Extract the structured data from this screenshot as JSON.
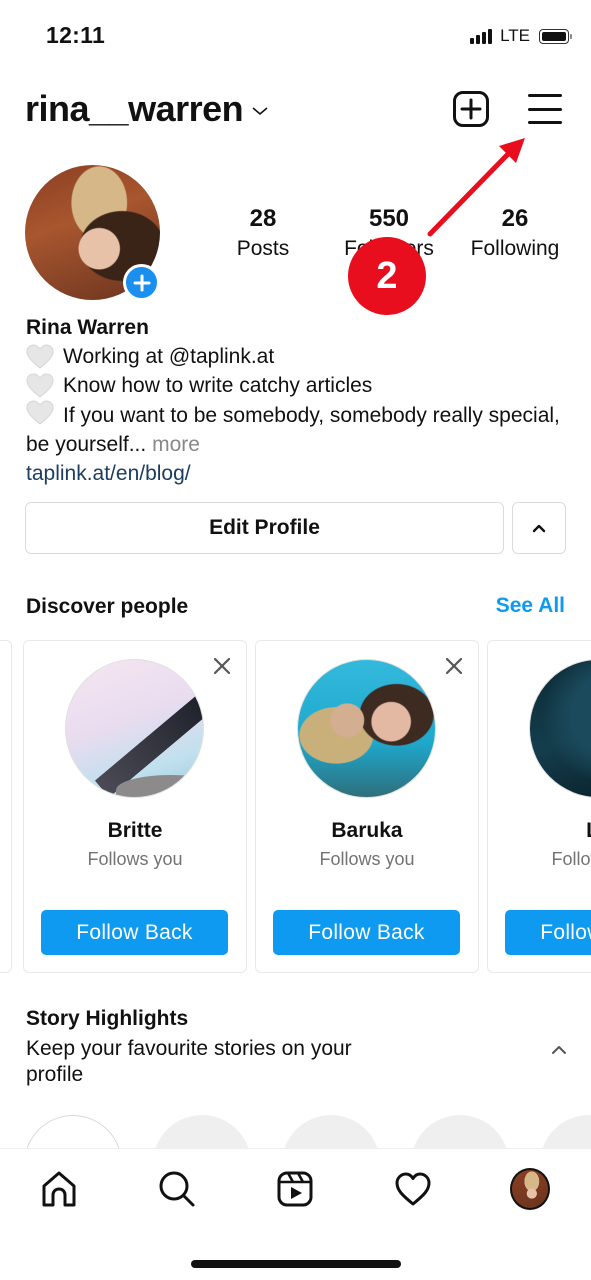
{
  "status_bar": {
    "time": "12:11",
    "network": "LTE",
    "signal_icon": "cellular-signal-icon",
    "battery_icon": "battery-icon"
  },
  "header": {
    "username": "rina__warren",
    "account_switch_icon": "chevron-down-icon",
    "new_post_icon": "plus-square-icon",
    "menu_icon": "hamburger-menu-icon"
  },
  "profile": {
    "avatar_icon": "profile-photo",
    "add_story_icon": "plus-circle-icon",
    "stats": [
      {
        "value": "28",
        "label": "Posts"
      },
      {
        "value": "550",
        "label": "Followers"
      },
      {
        "value": "26",
        "label": "Following"
      }
    ],
    "display_name": "Rina Warren",
    "bio_lines": [
      "Working at @taplink.at",
      "Know how to write catchy articles",
      "If you want to be somebody, somebody really special, be yourself..."
    ],
    "bio_icon": "white-heart-icon",
    "more_label": "more",
    "link": "taplink.at/en/blog/",
    "edit_profile_label": "Edit Profile",
    "expand_icon": "chevron-up-icon"
  },
  "annotation": {
    "step_number": "2",
    "arrow_target": "menu"
  },
  "discover": {
    "title": "Discover people",
    "see_all_label": "See All",
    "cards": [
      {
        "name": "Britte",
        "subtitle": "Follows you",
        "button": "Follow Back"
      },
      {
        "name": "Baruka",
        "subtitle": "Follows you",
        "button": "Follow Back"
      },
      {
        "name": "Lo",
        "subtitle": "Follows you",
        "button": "Follow Back"
      }
    ]
  },
  "story_highlights": {
    "title": "Story Highlights",
    "subtitle": "Keep your favourite stories on your profile",
    "collapse_icon": "chevron-up-icon"
  },
  "bottom_nav": {
    "items": [
      {
        "name": "home",
        "icon": "home-icon"
      },
      {
        "name": "search",
        "icon": "search-icon"
      },
      {
        "name": "reels",
        "icon": "reels-icon"
      },
      {
        "name": "activity",
        "icon": "heart-icon"
      },
      {
        "name": "profile",
        "icon": "profile-avatar-icon"
      }
    ]
  },
  "colors": {
    "accent_blue": "#0e9af0",
    "annotation_red": "#e80e1e",
    "link_color": "#1c3d61"
  }
}
